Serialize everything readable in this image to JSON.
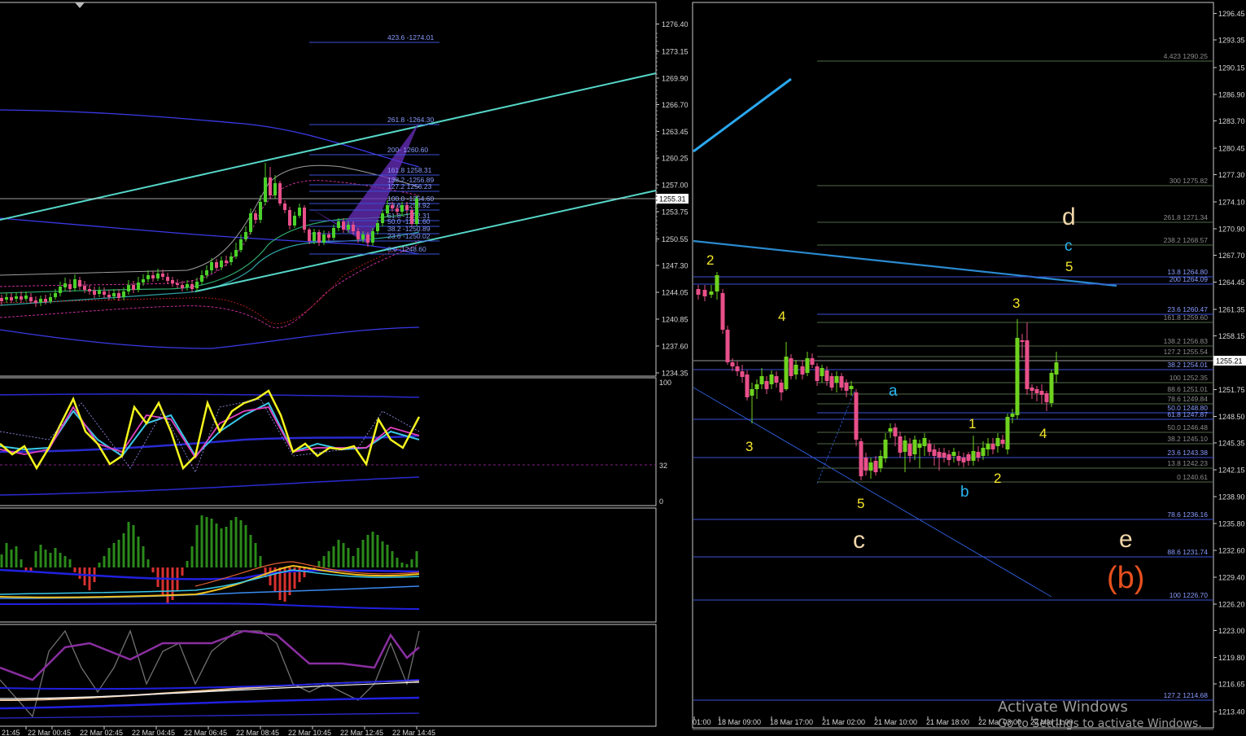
{
  "left_chart": {
    "price_axis": [
      "1276.40",
      "1273.15",
      "1269.90",
      "1266.70",
      "1263.45",
      "1260.25",
      "1257.00",
      "1253.75",
      "1250.55",
      "1247.30",
      "1244.05",
      "1240.85",
      "1237.60",
      "1234.35"
    ],
    "current_price": "1255.31",
    "fib_labels": [
      "423.6 -1274.01",
      "261.8 -1264.30",
      "200- 1260.60",
      "161.8 1258.31",
      "138.2 -1256.89",
      "127.2 1256.23",
      "100.0 -1254.60",
      "78.6 -1253.92",
      "61.8 -1252.31",
      "50.0 -1251.60",
      "38.2 -1250.89",
      "23.6 -1250.02",
      "0.0 -1248.60"
    ],
    "time_labels": [
      "21:45",
      "22 Mar 00:45",
      "22 Mar 02:45",
      "22 Mar 04:45",
      "22 Mar 06:45",
      "22 Mar 08:45",
      "22 Mar 10:45",
      "22 Mar 12:45",
      "22 Mar 14:45"
    ],
    "osc_levels": [
      "100",
      "32",
      "0"
    ]
  },
  "right_chart": {
    "price_axis": [
      "1296.45",
      "1293.35",
      "1290.15",
      "1286.90",
      "1283.70",
      "1280.45",
      "1277.30",
      "1274.10",
      "1270.90",
      "1267.70",
      "1264.45",
      "1261.35",
      "1258.15",
      "1255.21",
      "1251.75",
      "1248.50",
      "1245.35",
      "1242.15",
      "1238.90",
      "1235.80",
      "1232.60",
      "1229.40",
      "1226.20",
      "1223.00",
      "1219.80",
      "1216.65",
      "1213.40"
    ],
    "current_price": "1255.21",
    "fib_labels": [
      "4.423 1290.25",
      "300 1275.82",
      "261.8 1271.34",
      "238.2 1268.57",
      "13.8 1264.80",
      "200 1264.09",
      "23.6 1260.47",
      "161.8 1259.60",
      "138.2 1256.83",
      "127.2 1255.54",
      "38.2 1254.01",
      "100 1252.35",
      "88.6 1251.01",
      "78.6 1249.84",
      "50.0 1248.80",
      "61.8 1247.87",
      "50.0 1246.48",
      "38.2 1245.10",
      "23.6 1243.38",
      "13.8 1242.23",
      "0 1240.61",
      "78.6 1236.16",
      "88.6 1231.74",
      "100 1226.70",
      "127.2 1214.68"
    ],
    "time_labels": [
      "01:00",
      "18 Mar 09:00",
      "18 Mar 17:00",
      "21 Mar 02:00",
      "21 Mar 10:00",
      "21 Mar 18:00",
      "22 Mar 03:00",
      "22 Mar 11:00"
    ],
    "wave_labels": {
      "w2": "2",
      "w4a": "4",
      "w3a": "3",
      "w5a": "5",
      "c_main": "c",
      "a": "a",
      "b": "b",
      "w1": "1",
      "w2b": "2",
      "w3b": "3",
      "w4b": "4",
      "d": "d",
      "c_small": "c",
      "w5b": "5",
      "e": "e",
      "b_paren": "(b)"
    }
  },
  "watermark": {
    "line1": "Activate Windows",
    "line2": "Go to Settings to activate Windows."
  },
  "chart_data": [
    {
      "type": "candlestick",
      "title": "",
      "x": [
        "21:45",
        "22 Mar 00:45",
        "22 Mar 02:45",
        "22 Mar 04:45",
        "22 Mar 06:45",
        "22 Mar 08:45",
        "22 Mar 10:45",
        "22 Mar 12:45",
        "22 Mar 14:45"
      ],
      "close": [
        1243.0,
        1244.6,
        1245.1,
        1246.8,
        1246.5,
        1259.5,
        1251.4,
        1252.5,
        1255.3
      ],
      "last_price": 1255.31,
      "ylim": [
        1234.35,
        1278.0
      ],
      "fibonacci": [
        {
          "level": "423.6",
          "price": 1274.01
        },
        {
          "level": "261.8",
          "price": 1264.3
        },
        {
          "level": "200",
          "price": 1260.6
        },
        {
          "level": "161.8",
          "price": 1258.31
        },
        {
          "level": "138.2",
          "price": 1256.89
        },
        {
          "level": "127.2",
          "price": 1256.23
        },
        {
          "level": "100.0",
          "price": 1254.6
        },
        {
          "level": "78.6",
          "price": 1253.92
        },
        {
          "level": "61.8",
          "price": 1252.31
        },
        {
          "level": "50.0",
          "price": 1251.6
        },
        {
          "level": "38.2",
          "price": 1250.89
        },
        {
          "level": "23.6",
          "price": 1250.02
        },
        {
          "level": "0.0",
          "price": 1248.6
        }
      ],
      "oscillator_levels": [
        100,
        32,
        0
      ]
    },
    {
      "type": "candlestick",
      "title": "",
      "x": [
        "01:00",
        "18 Mar 09:00",
        "18 Mar 17:00",
        "21 Mar 02:00",
        "21 Mar 10:00",
        "21 Mar 18:00",
        "22 Mar 03:00",
        "22 Mar 11:00"
      ],
      "close": [
        1262.0,
        1251.5,
        1254.5,
        1246.0,
        1243.5,
        1243.5,
        1249.0,
        1255.2
      ],
      "last_price": 1255.21,
      "ylim": [
        1213.4,
        1297.5
      ],
      "fibonacci": [
        {
          "level": "4.423",
          "price": 1290.25
        },
        {
          "level": "300",
          "price": 1275.82
        },
        {
          "level": "261.8",
          "price": 1271.34
        },
        {
          "level": "238.2",
          "price": 1268.57
        },
        {
          "level": "13.8",
          "price": 1264.8
        },
        {
          "level": "200",
          "price": 1264.09
        },
        {
          "level": "23.6",
          "price": 1260.47
        },
        {
          "level": "161.8",
          "price": 1259.6
        },
        {
          "level": "138.2",
          "price": 1256.83
        },
        {
          "level": "127.2",
          "price": 1255.54
        },
        {
          "level": "38.2",
          "price": 1254.01
        },
        {
          "level": "100",
          "price": 1252.35
        },
        {
          "level": "88.6",
          "price": 1251.01
        },
        {
          "level": "78.6",
          "price": 1249.84
        },
        {
          "level": "50.0",
          "price": 1248.8
        },
        {
          "level": "61.8",
          "price": 1247.87
        },
        {
          "level": "50.0",
          "price": 1246.48
        },
        {
          "level": "38.2",
          "price": 1245.1
        },
        {
          "level": "23.6",
          "price": 1243.38
        },
        {
          "level": "13.8",
          "price": 1242.23
        },
        {
          "level": "0",
          "price": 1240.61
        },
        {
          "level": "78.6",
          "price": 1236.16
        },
        {
          "level": "88.6",
          "price": 1231.74
        },
        {
          "level": "100",
          "price": 1226.7
        },
        {
          "level": "127.2",
          "price": 1214.68
        }
      ],
      "annotations": [
        "2",
        "4",
        "3",
        "5",
        "c",
        "a",
        "b",
        "1",
        "2",
        "3",
        "4",
        "d",
        "c",
        "5",
        "e",
        "(b)"
      ]
    }
  ]
}
